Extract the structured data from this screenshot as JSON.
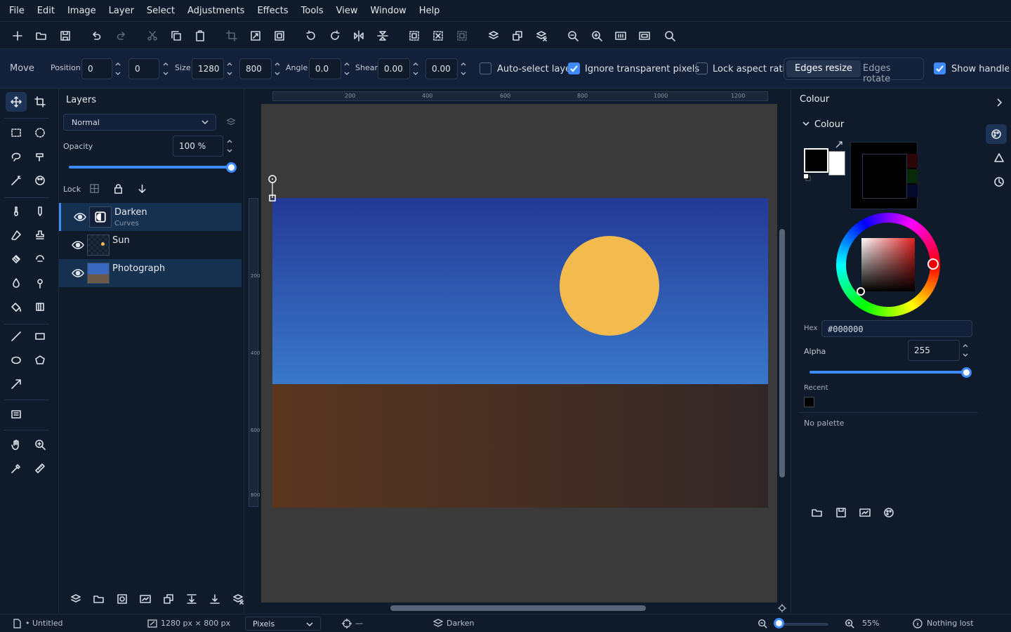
{
  "menu": [
    "File",
    "Edit",
    "Image",
    "Layer",
    "Select",
    "Adjustments",
    "Effects",
    "Tools",
    "View",
    "Window",
    "Help"
  ],
  "options": {
    "tool_name": "Move",
    "position_label": "Position",
    "pos_x": "0",
    "pos_y": "0",
    "size_label": "Size",
    "width": "1280",
    "height": "800",
    "angle_label": "Angle",
    "angle": "0.0",
    "shear_label": "Shear",
    "shear_x": "0.00",
    "shear_y": "0.00",
    "auto_select": "Auto-select layer",
    "ignore_transparent": "Ignore transparent pixels",
    "lock_aspect": "Lock aspect ratio",
    "edges_resize": "Edges resize",
    "edges_rotate": "Edges rotate",
    "show_handles": "Show handles"
  },
  "layers_panel": {
    "title": "Layers",
    "blend_mode": "Normal",
    "opacity_label": "Opacity",
    "opacity_value": "100 %",
    "opacity_fraction": 1.0,
    "lock_label": "Lock",
    "layers": [
      {
        "name": "Darken",
        "subtitle": "Curves"
      },
      {
        "name": "Sun",
        "subtitle": ""
      },
      {
        "name": "Photograph",
        "subtitle": ""
      }
    ]
  },
  "rulers": {
    "h": [
      "200",
      "400",
      "600",
      "800",
      "1000",
      "1200"
    ],
    "v": [
      "200",
      "400",
      "600",
      "800"
    ]
  },
  "colour_panel": {
    "title": "Colour",
    "section": "Colour",
    "hex_label": "Hex",
    "hex_value": "#000000",
    "alpha_label": "Alpha",
    "alpha_value": "255",
    "alpha_fraction": 1.0,
    "recent_label": "Recent",
    "palette_text": "No palette",
    "primary_color": "#000000",
    "secondary_color": "#ffffff"
  },
  "status": {
    "doc": "• Untitled",
    "dimensions": "1280 px × 800 px",
    "units": "Pixels",
    "cursor": "—",
    "layer": "Darken",
    "zoom": "55%",
    "history": "Nothing lost"
  },
  "colors": {
    "accent": "#3d8bfd",
    "sun": "#f3bb4d",
    "sky_top": "#243996",
    "sky_bottom": "#3a78c9",
    "ground_left": "#5a361f",
    "ground_right": "#322728"
  }
}
